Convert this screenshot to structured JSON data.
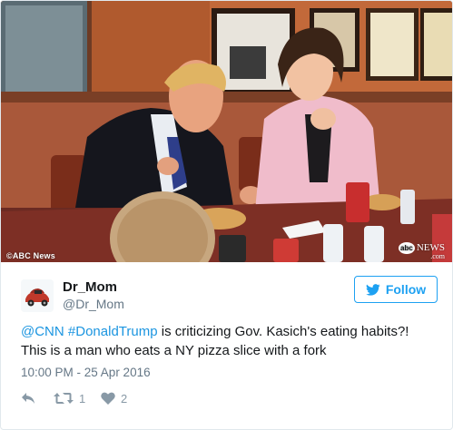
{
  "photo": {
    "credit": "©ABC News",
    "watermark_brand": "NEWS",
    "watermark_suffix": ".com",
    "watermark_logo": "abc"
  },
  "author": {
    "display_name": "Dr_Mom",
    "screen_name": "@Dr_Mom",
    "avatar_icon": "car-avatar-icon"
  },
  "follow_button": {
    "label": "Follow",
    "icon": "twitter-bird-icon"
  },
  "tweet": {
    "mention": "@CNN",
    "hashtag": "#DonaldTrump",
    "text_after_hashtag": " is criticizing Gov. Kasich's eating habits?!",
    "line2": "This is a man who eats a NY pizza slice with a fork",
    "timestamp": "10:00 PM - 25 Apr 2016"
  },
  "actions": {
    "reply_icon": "reply-icon",
    "retweet_icon": "retweet-icon",
    "retweet_count": "1",
    "like_icon": "heart-icon",
    "like_count": "2"
  },
  "colors": {
    "link_blue": "#1b95e0",
    "follow_blue": "#1da1f2",
    "muted_gray": "#657786",
    "icon_gray": "#8899a6"
  }
}
